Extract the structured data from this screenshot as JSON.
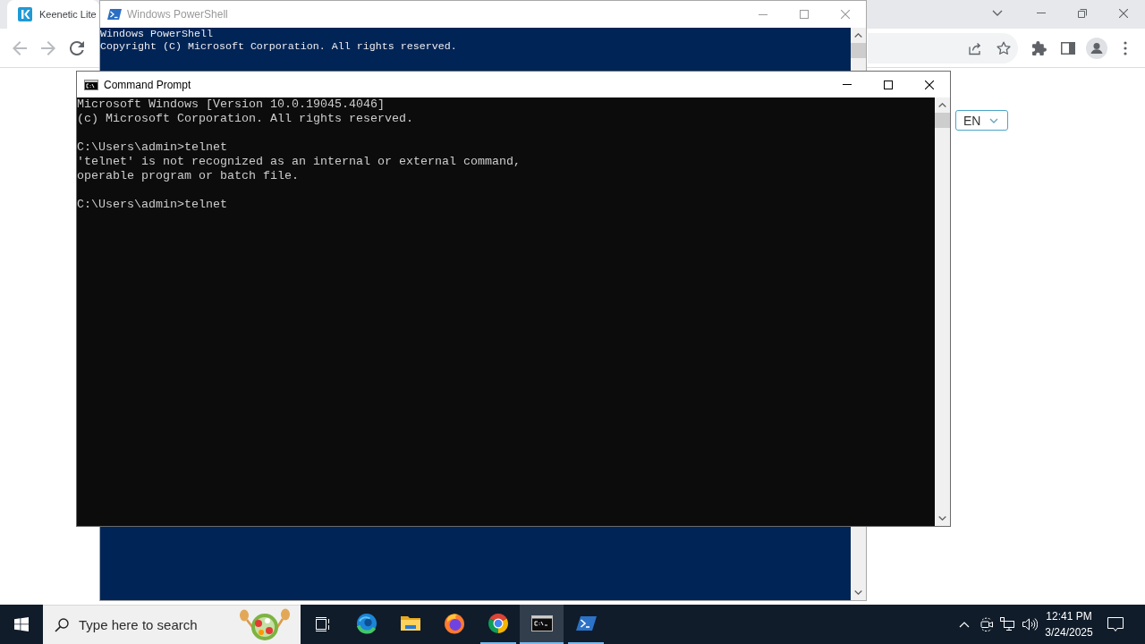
{
  "browser": {
    "tabs": [
      {
        "title": "Keenetic Lite",
        "selected": true
      }
    ],
    "back": {
      "disabled": true
    },
    "forward": {
      "disabled": true
    },
    "language_select": {
      "value": "EN"
    }
  },
  "windows": [
    {
      "kind": "powershell",
      "title": "Windows PowerShell",
      "active": false,
      "output": [
        [
          "Windows PowerShell",
          "Copyright (C) Microsoft Corporation. All rights reserved."
        ]
      ]
    },
    {
      "kind": "cmd",
      "title": "Command Prompt",
      "active": true,
      "output": [
        [
          "Microsoft Windows [Version 10.0.19045.4046]",
          "(c) Microsoft Corporation. All rights reserved."
        ],
        [
          "C:\\Users\\admin>telnet",
          "'telnet' is not recognized as an internal or external command,",
          "operable program or batch file."
        ],
        [
          "C:\\Users\\admin>telnet"
        ]
      ]
    }
  ],
  "taskbar": {
    "search": {
      "placeholder": "Type here to search"
    },
    "apps": [
      {
        "kind": "edge",
        "running": false,
        "selected": false
      },
      {
        "kind": "explorer",
        "running": false,
        "selected": false
      },
      {
        "kind": "firefox",
        "running": false,
        "selected": false
      },
      {
        "kind": "chrome",
        "running": true,
        "selected": false
      },
      {
        "kind": "cmd",
        "running": true,
        "selected": true
      },
      {
        "kind": "powershell",
        "running": true,
        "selected": false
      }
    ],
    "clock": {
      "time": "12:41 PM",
      "date": "3/24/2025"
    }
  }
}
